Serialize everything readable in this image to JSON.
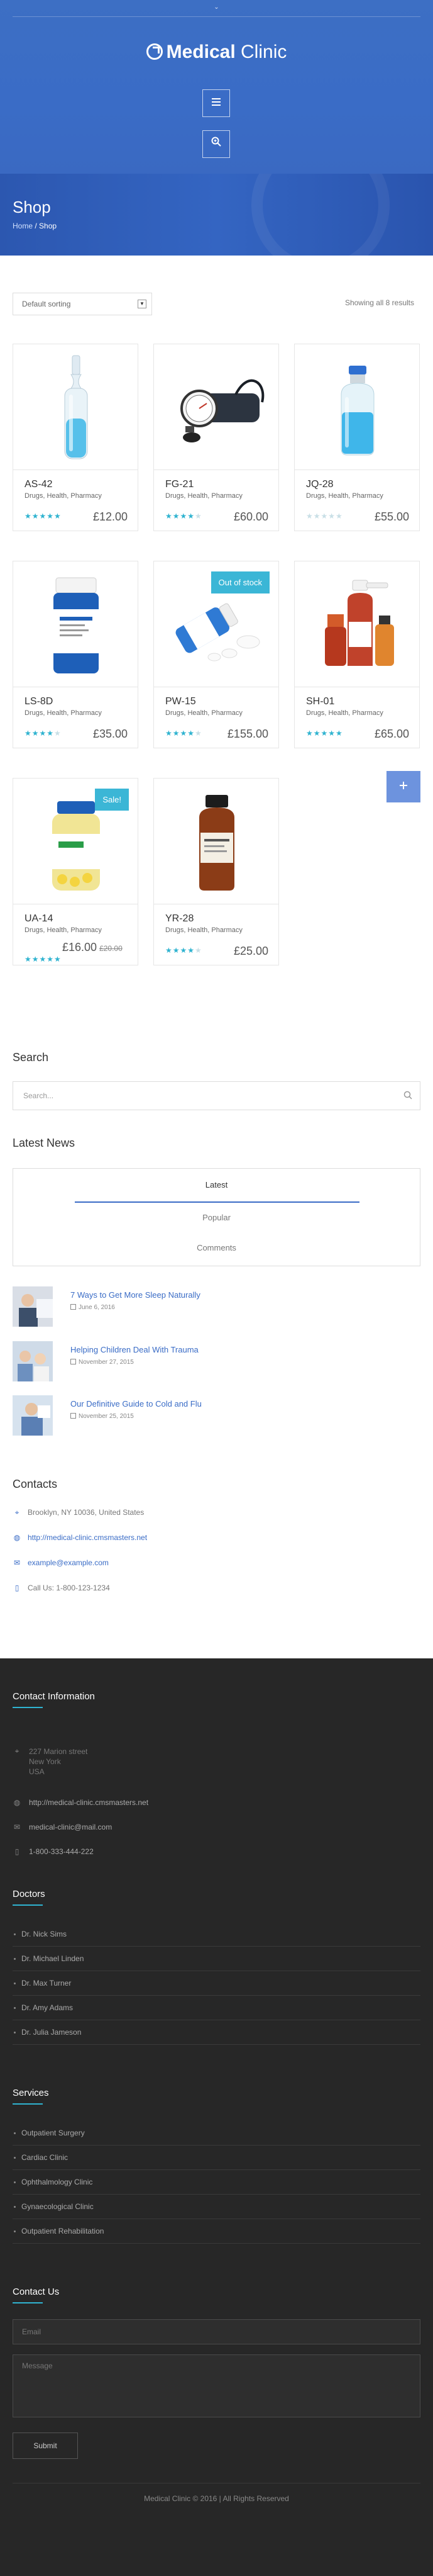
{
  "brand": {
    "name_bold": "Medical",
    "name_light": "Clinic"
  },
  "header": {
    "menu_icon": "menu-icon",
    "search_icon": "search-zoom-icon"
  },
  "page": {
    "title": "Shop",
    "breadcrumb_home": "Home",
    "breadcrumb_sep": " / ",
    "breadcrumb_current": "Shop"
  },
  "shop": {
    "sorting": "Default sorting",
    "result_count": "Showing all 8 results",
    "products": [
      {
        "name": "AS-42",
        "cats": "Drugs, Health, Pharmacy",
        "rating": 5,
        "price": "£12.00"
      },
      {
        "name": "FG-21",
        "cats": "Drugs, Health, Pharmacy",
        "rating": 4,
        "price": "£60.00"
      },
      {
        "name": "JQ-28",
        "cats": "Drugs, Health, Pharmacy",
        "rating": 0,
        "price": "£55.00"
      },
      {
        "name": "LS-8D",
        "cats": "Drugs, Health, Pharmacy",
        "rating": 4,
        "price": "£35.00"
      },
      {
        "name": "PW-15",
        "cats": "Drugs, Health, Pharmacy",
        "rating": 4,
        "price": "£155.00",
        "badge": "Out of stock"
      },
      {
        "name": "SH-01",
        "cats": "Drugs, Health, Pharmacy",
        "rating": 5,
        "price": "£65.00"
      },
      {
        "name": "UA-14",
        "cats": "Drugs, Health, Pharmacy",
        "rating": 5,
        "price": "£16.00",
        "old_price": "£20.00",
        "badge": "Sale!"
      },
      {
        "name": "YR-28",
        "cats": "Drugs, Health, Pharmacy",
        "rating": 4,
        "price": "£25.00"
      }
    ]
  },
  "search": {
    "title": "Search",
    "placeholder": "Search..."
  },
  "latest_news": {
    "title": "Latest News",
    "tabs": [
      "Latest",
      "Popular",
      "Comments"
    ],
    "items": [
      {
        "title": "7 Ways to Get More Sleep Naturally",
        "date": "June 6, 2016"
      },
      {
        "title": "Helping Children Deal With Trauma",
        "date": "November 27, 2015"
      },
      {
        "title": "Our Definitive Guide to Cold and Flu",
        "date": "November 25, 2015"
      }
    ]
  },
  "contacts": {
    "title": "Contacts",
    "address": "Brooklyn, NY 10036, United States",
    "website": "http://medical-clinic.cmsmasters.net",
    "email": "example@example.com",
    "phone": "Call Us: 1-800-123-1234"
  },
  "footer": {
    "contact_title": "Contact Information",
    "address_lines": [
      "227 Marion street",
      "New York",
      "USA"
    ],
    "website": "http://medical-clinic.cmsmasters.net",
    "email": "medical-clinic@mail.com",
    "phone": "1-800-333-444-222",
    "doctors_title": "Doctors",
    "doctors": [
      "Dr. Nick Sims",
      "Dr. Michael Linden",
      "Dr. Max Turner",
      "Dr. Amy Adams",
      "Dr. Julia Jameson"
    ],
    "services_title": "Services",
    "services": [
      "Outpatient Surgery",
      "Cardiac Clinic",
      "Ophthalmology Clinic",
      "Gynaecological Clinic",
      "Outpatient Rehabilitation"
    ],
    "contact_us_title": "Contact Us",
    "email_placeholder": "Email",
    "message_placeholder": "Message",
    "submit_label": "Submit",
    "copyright": "Medical Clinic © 2016 | All Rights Reserved"
  }
}
